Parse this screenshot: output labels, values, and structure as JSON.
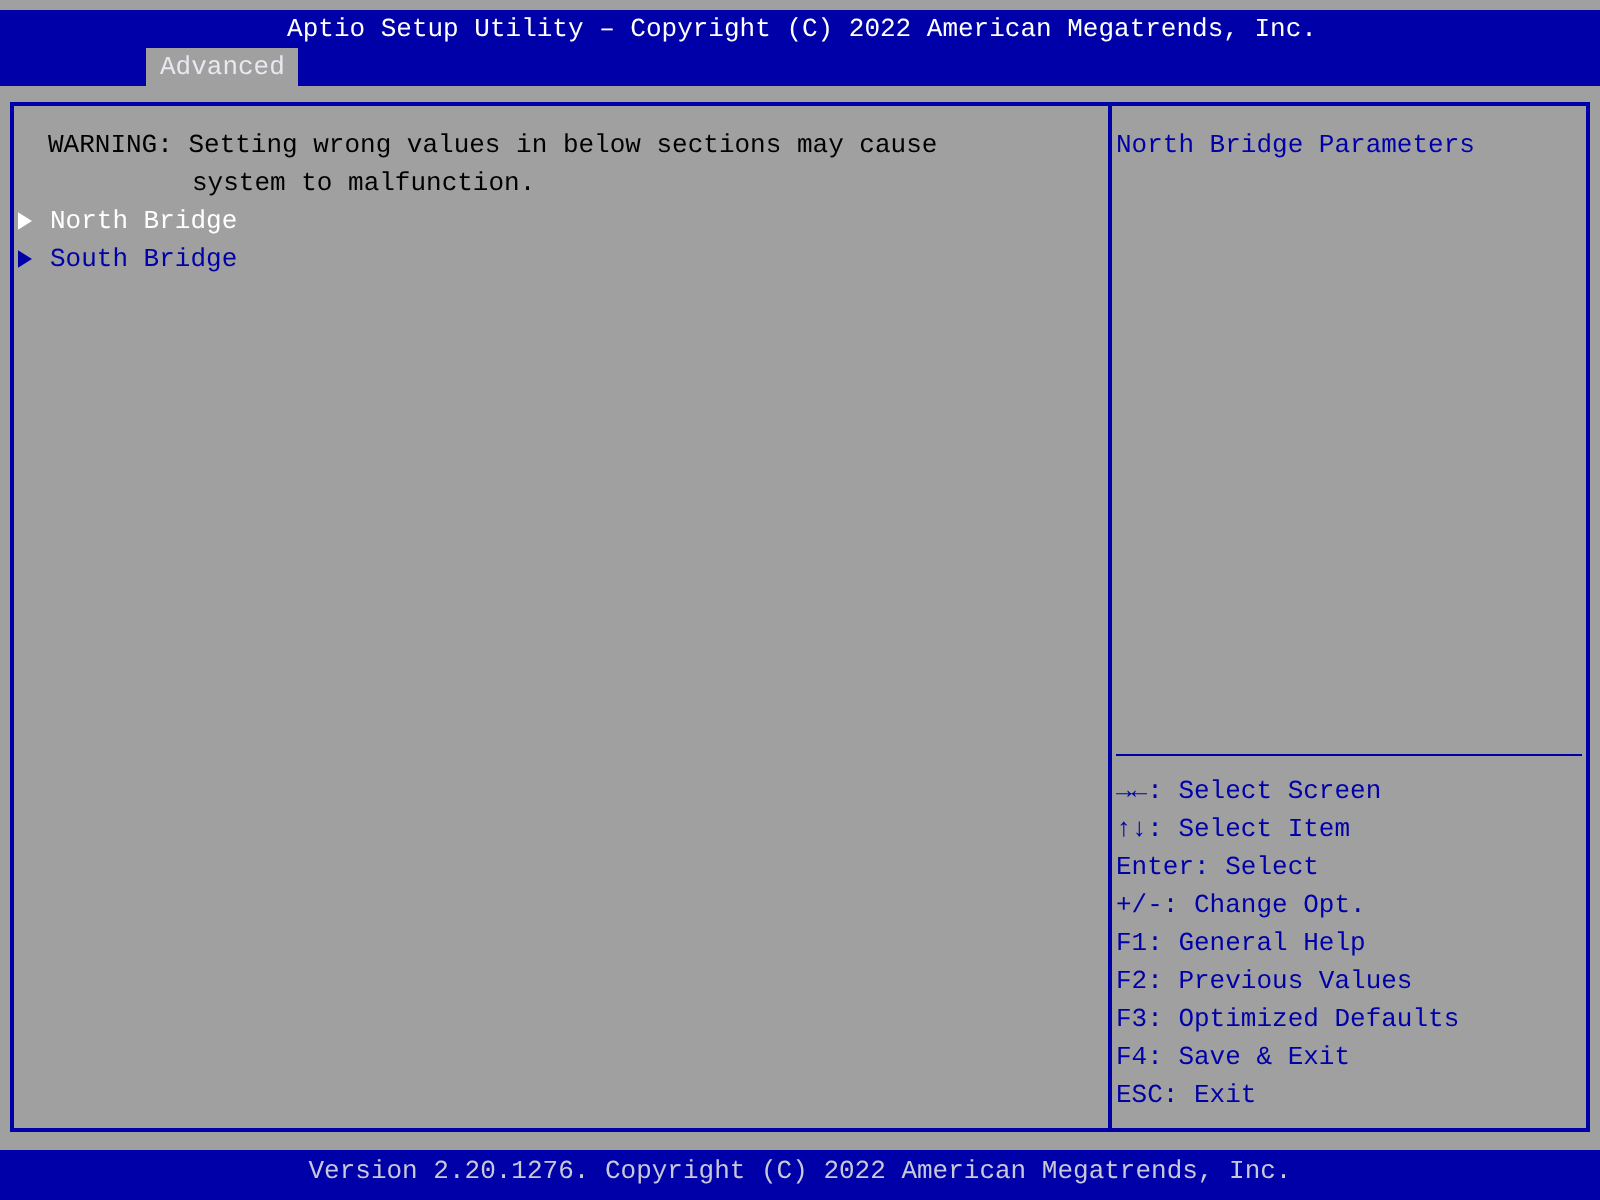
{
  "window": {
    "title": "Aptio Setup Utility – Copyright (C) 2022 American Megatrends, Inc."
  },
  "tabs": [
    {
      "label": "Advanced",
      "selected": true
    }
  ],
  "warning": [
    "WARNING: Setting wrong values in below sections may cause",
    "system to malfunction."
  ],
  "items": [
    {
      "label": "North Bridge",
      "kind": "submenu",
      "selected": true
    },
    {
      "label": "South Bridge",
      "kind": "submenu",
      "selected": false
    }
  ],
  "help_text": "North Bridge Parameters",
  "key_help": [
    "→←: Select Screen",
    "↑↓: Select Item",
    "Enter: Select",
    "+/-: Change Opt.",
    "F1: General Help",
    "F2: Previous Values",
    "F3: Optimized Defaults",
    "F4: Save & Exit",
    "ESC: Exit"
  ],
  "status_bar": "Version 2.20.1276. Copyright (C) 2022 American Megatrends, Inc."
}
